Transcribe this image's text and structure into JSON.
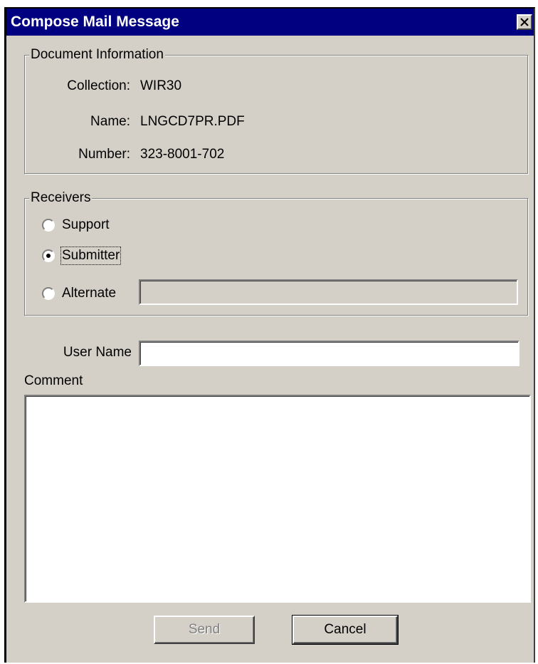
{
  "window": {
    "title": "Compose Mail Message"
  },
  "document_info": {
    "legend": "Document Information",
    "collection_label": "Collection:",
    "collection_value": "WIR30",
    "name_label": "Name:",
    "name_value": "LNGCD7PR.PDF",
    "number_label": "Number:",
    "number_value": "323-8001-702"
  },
  "receivers": {
    "legend": "Receivers",
    "support_label": "Support",
    "submitter_label": "Submitter",
    "alternate_label": "Alternate",
    "selected": "Submitter",
    "alternate_value": ""
  },
  "form": {
    "user_name_label": "User Name",
    "user_name_value": "",
    "comment_label": "Comment",
    "comment_value": ""
  },
  "buttons": {
    "send_label": "Send",
    "cancel_label": "Cancel"
  },
  "colors": {
    "titlebar": "#000080",
    "face": "#d4d0c8"
  }
}
